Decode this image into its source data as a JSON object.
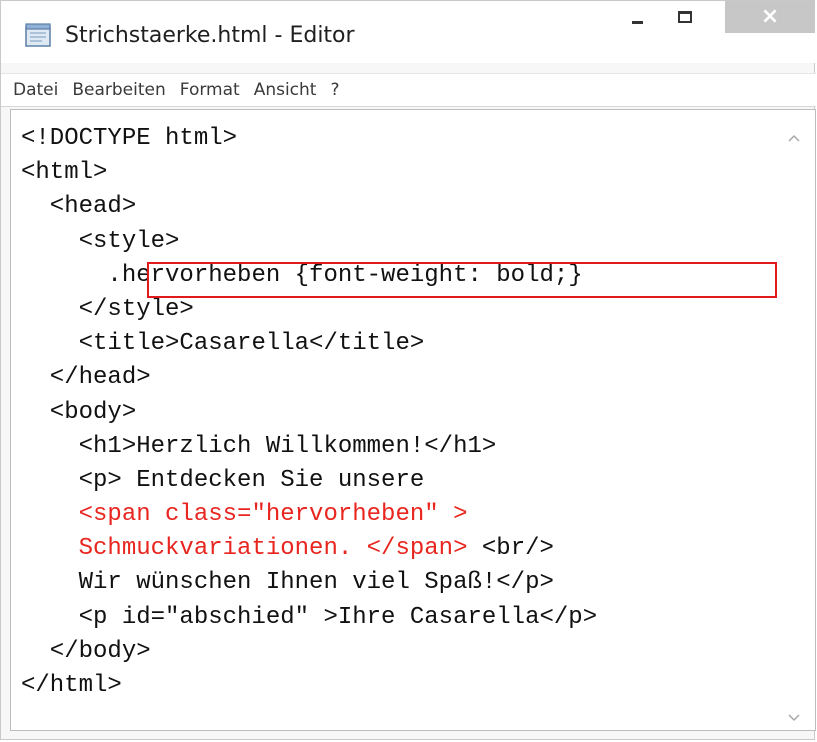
{
  "window": {
    "title": "Strichstaerke.html - Editor",
    "close_symbol": "×"
  },
  "icons": {
    "app": "notepad-icon",
    "minimize": "minimize-icon",
    "maximize": "maximize-icon",
    "close": "close-icon",
    "scroll_up": "chevron-up-icon",
    "scroll_down": "chevron-down-icon"
  },
  "menu": {
    "items": [
      "Datei",
      "Bearbeiten",
      "Format",
      "Ansicht",
      "?"
    ]
  },
  "colors": {
    "highlight_box": "#e0191b",
    "red_code": "#e8251f"
  },
  "editor": {
    "lines": [
      "<!DOCTYPE html>",
      "<html>",
      "  <head>",
      "    <style>",
      "      .hervorheben {font-weight: bold;}",
      "    </style>",
      "    <title>Casarella</title>",
      "  </head>",
      "  <body>",
      "    <h1>Herzlich Willkommen!</h1>",
      "    <p> Entdecken Sie unsere",
      "    <span class=\"hervorheben\" >",
      "    Schmuckvariationen. </span>",
      " <br/>",
      "    Wir wünschen Ihnen viel Spaß!</p>",
      "    <p id=\"abschied\" >Ihre Casarella</p>",
      "  </body>",
      "</html>"
    ]
  }
}
